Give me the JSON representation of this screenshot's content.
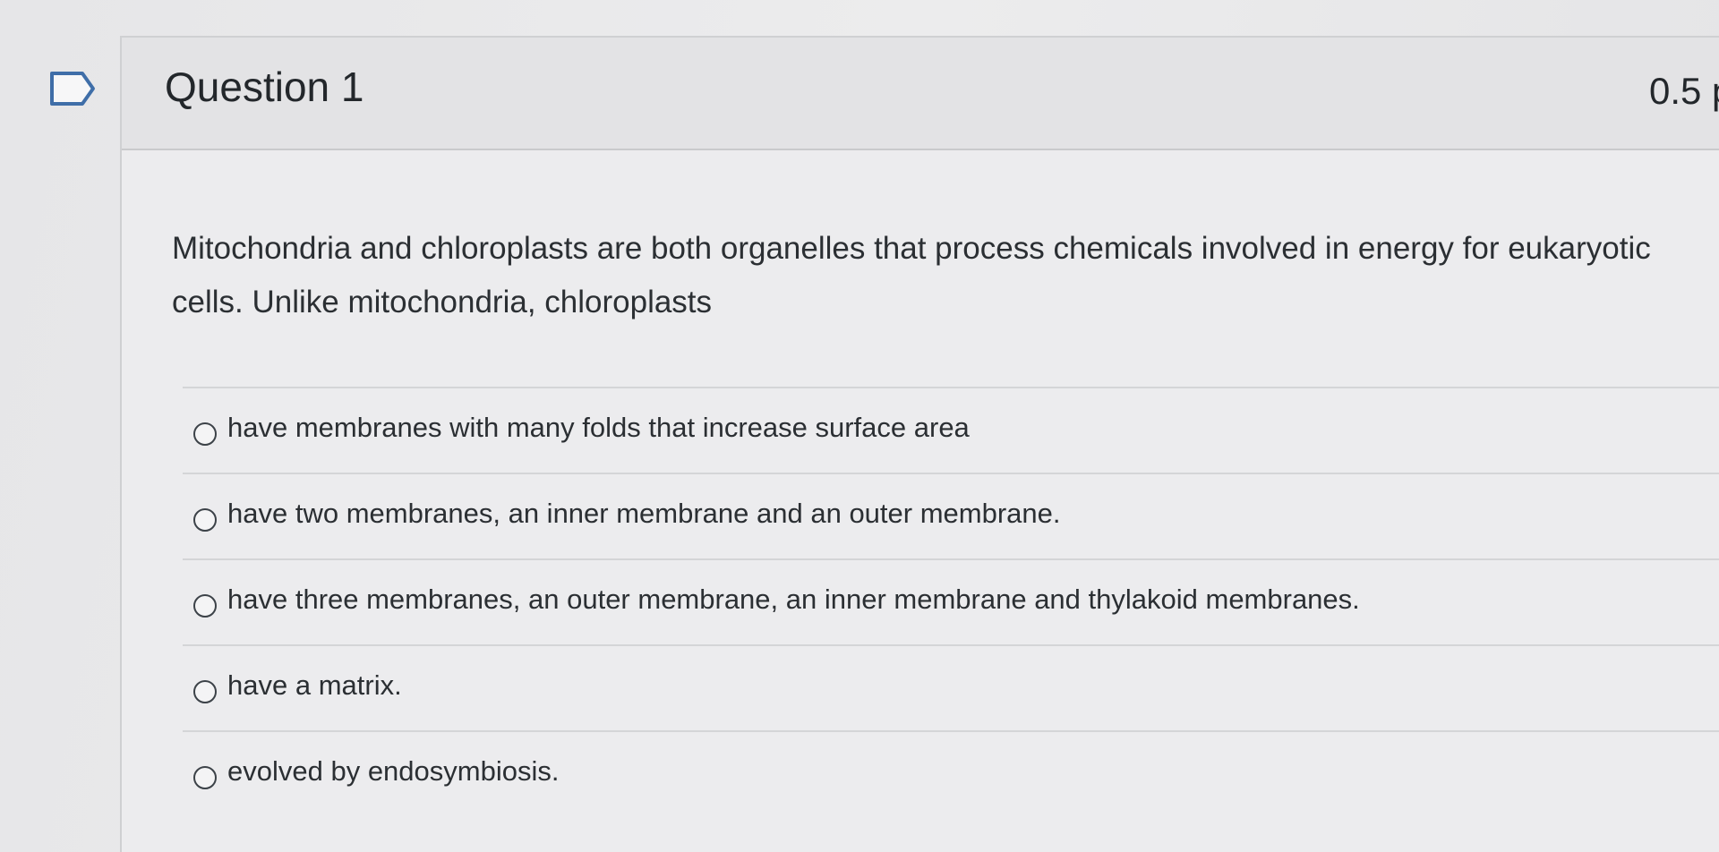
{
  "question": {
    "title": "Question 1",
    "points": "0.5 p",
    "text": "Mitochondria and chloroplasts are both organelles that process chemicals involved in energy for eukaryotic cells. Unlike mitochondria, chloroplasts",
    "flag_icon": "flag-outline-icon"
  },
  "answers": [
    {
      "label": "have membranes with many folds that increase surface area",
      "selected": false
    },
    {
      "label": "have two membranes, an inner membrane and an outer membrane.",
      "selected": false
    },
    {
      "label": "have three membranes, an outer membrane, an inner membrane and thylakoid membranes.",
      "selected": false
    },
    {
      "label": "have a matrix.",
      "selected": false
    },
    {
      "label": "evolved by endosymbiosis.",
      "selected": false
    }
  ]
}
